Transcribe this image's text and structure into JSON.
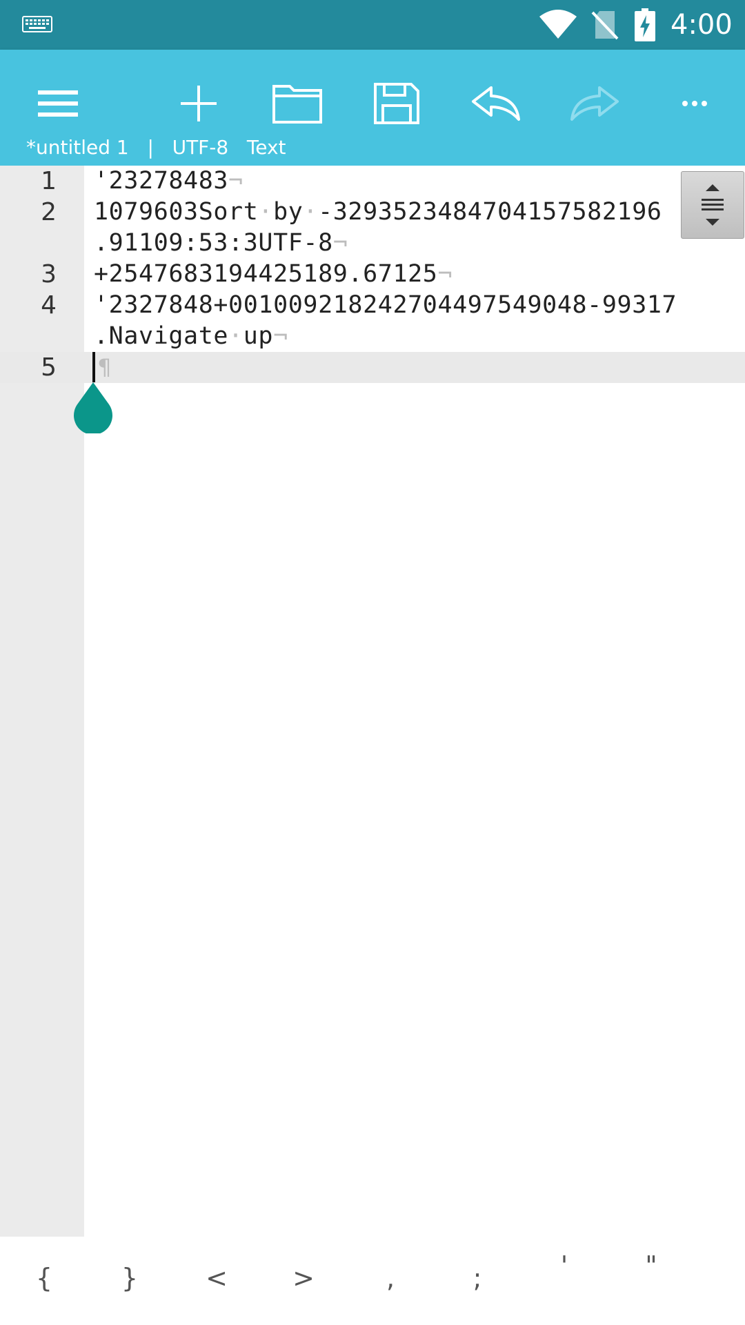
{
  "status_bar": {
    "time": "4:00",
    "icons": [
      "keyboard-icon",
      "wifi-icon",
      "no-sim-icon",
      "battery-charging-icon"
    ]
  },
  "toolbar": {
    "buttons": [
      "menu-icon",
      "new-file-icon",
      "open-folder-icon",
      "save-icon",
      "undo-icon",
      "redo-icon",
      "more-icon"
    ],
    "file_name": "*untitled 1",
    "separator": "|",
    "encoding": "UTF-8",
    "mode": "Text"
  },
  "editor": {
    "line_numbers": [
      "1",
      "2",
      "3",
      "4",
      "5"
    ],
    "lines": [
      {
        "text": "'23278483",
        "eol": "¬"
      },
      {
        "text": "1079603Sort·by·-32935234847041575821​96",
        "eol": ""
      },
      {
        "text": ".91109:53:3UTF-8",
        "eol": "¬"
      },
      {
        "text": "+2547683194425189.67125",
        "eol": "¬"
      },
      {
        "text": "'2327848+001009218242704497549048-99317",
        "eol": ""
      },
      {
        "text": ".Navigate·up",
        "eol": "¬"
      }
    ],
    "current_line_marker": "¶",
    "current_line": 5
  },
  "symbol_bar": {
    "symbols": [
      "{",
      "}",
      "<",
      ">",
      ",",
      ";",
      "'",
      "\""
    ]
  },
  "colors": {
    "status_bar": "#238a9c",
    "toolbar": "#48c3df",
    "handle": "#0b968a",
    "gutter": "#ebebeb"
  }
}
